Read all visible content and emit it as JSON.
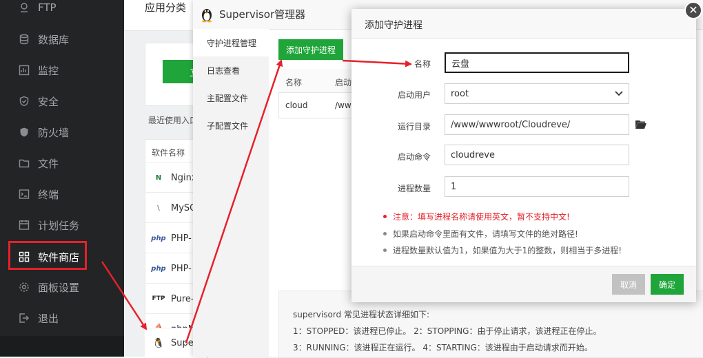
{
  "sidebar": {
    "items": [
      {
        "label": "FTP",
        "icon": "ftp-icon"
      },
      {
        "label": "数据库",
        "icon": "database-icon"
      },
      {
        "label": "监控",
        "icon": "monitor-icon"
      },
      {
        "label": "安全",
        "icon": "shield-icon"
      },
      {
        "label": "防火墙",
        "icon": "firewall-icon"
      },
      {
        "label": "文件",
        "icon": "folder-icon"
      },
      {
        "label": "终端",
        "icon": "terminal-icon"
      },
      {
        "label": "计划任务",
        "icon": "clock-icon"
      },
      {
        "label": "软件商店",
        "icon": "grid-icon"
      },
      {
        "label": "面板设置",
        "icon": "gear-icon"
      },
      {
        "label": "退出",
        "icon": "logout-icon"
      }
    ]
  },
  "store": {
    "category_title": "应用分类",
    "green_button": "立",
    "recent": "最近使用入口",
    "table_header": "软件名称",
    "rows": [
      {
        "logo": "N",
        "name": "Nginx"
      },
      {
        "logo": "\\",
        "name": "MySQL"
      },
      {
        "logo": "php",
        "name": "PHP-"
      },
      {
        "logo": "php",
        "name": "PHP-"
      },
      {
        "logo": "FTP",
        "name": "Pure-"
      },
      {
        "logo": "⛵",
        "name": "phpM"
      },
      {
        "logo": "🐧",
        "name": "Supe"
      }
    ]
  },
  "supervisor": {
    "title": "Supervisor管理器",
    "tabs": [
      "守护进程管理",
      "日志查看",
      "主配置文件",
      "子配置文件"
    ],
    "add_button": "添加守护进程",
    "table": {
      "headers": [
        "名称",
        "启动"
      ],
      "rows": [
        [
          "cloud",
          "/ww"
        ]
      ]
    },
    "info": {
      "title": "supervisord 常见进程状态详细如下:",
      "line1": "1：STOPPED：该进程已停止。    2：STOPPING：由于停止请求，该进程正在停止。",
      "line2": "3：RUNNING：该进程正在运行。  4：STARTING：该进程由于启动请求而开始。"
    }
  },
  "modal": {
    "title": "添加守护进程",
    "close": "✕",
    "fields": {
      "name_label": "名称",
      "name_value": "云盘",
      "user_label": "启动用户",
      "user_value": "root",
      "dir_label": "运行目录",
      "dir_value": "/www/wwwroot/Cloudreve/",
      "cmd_label": "启动命令",
      "cmd_value": "cloudreve",
      "count_label": "进程数量",
      "count_value": "1"
    },
    "tips": [
      "注意：填写进程名称请使用英文，暂不支持中文!",
      "如果启动命令里面有文件，请填写文件的绝对路径!",
      "进程数量默认值为1，如果值为大于1的整数，则相当于多进程!"
    ],
    "cancel": "取消",
    "confirm": "确定"
  },
  "colors": {
    "sidebar_bg": "#232426",
    "accent_green": "#20a53a",
    "highlight_red": "#e5212a"
  }
}
